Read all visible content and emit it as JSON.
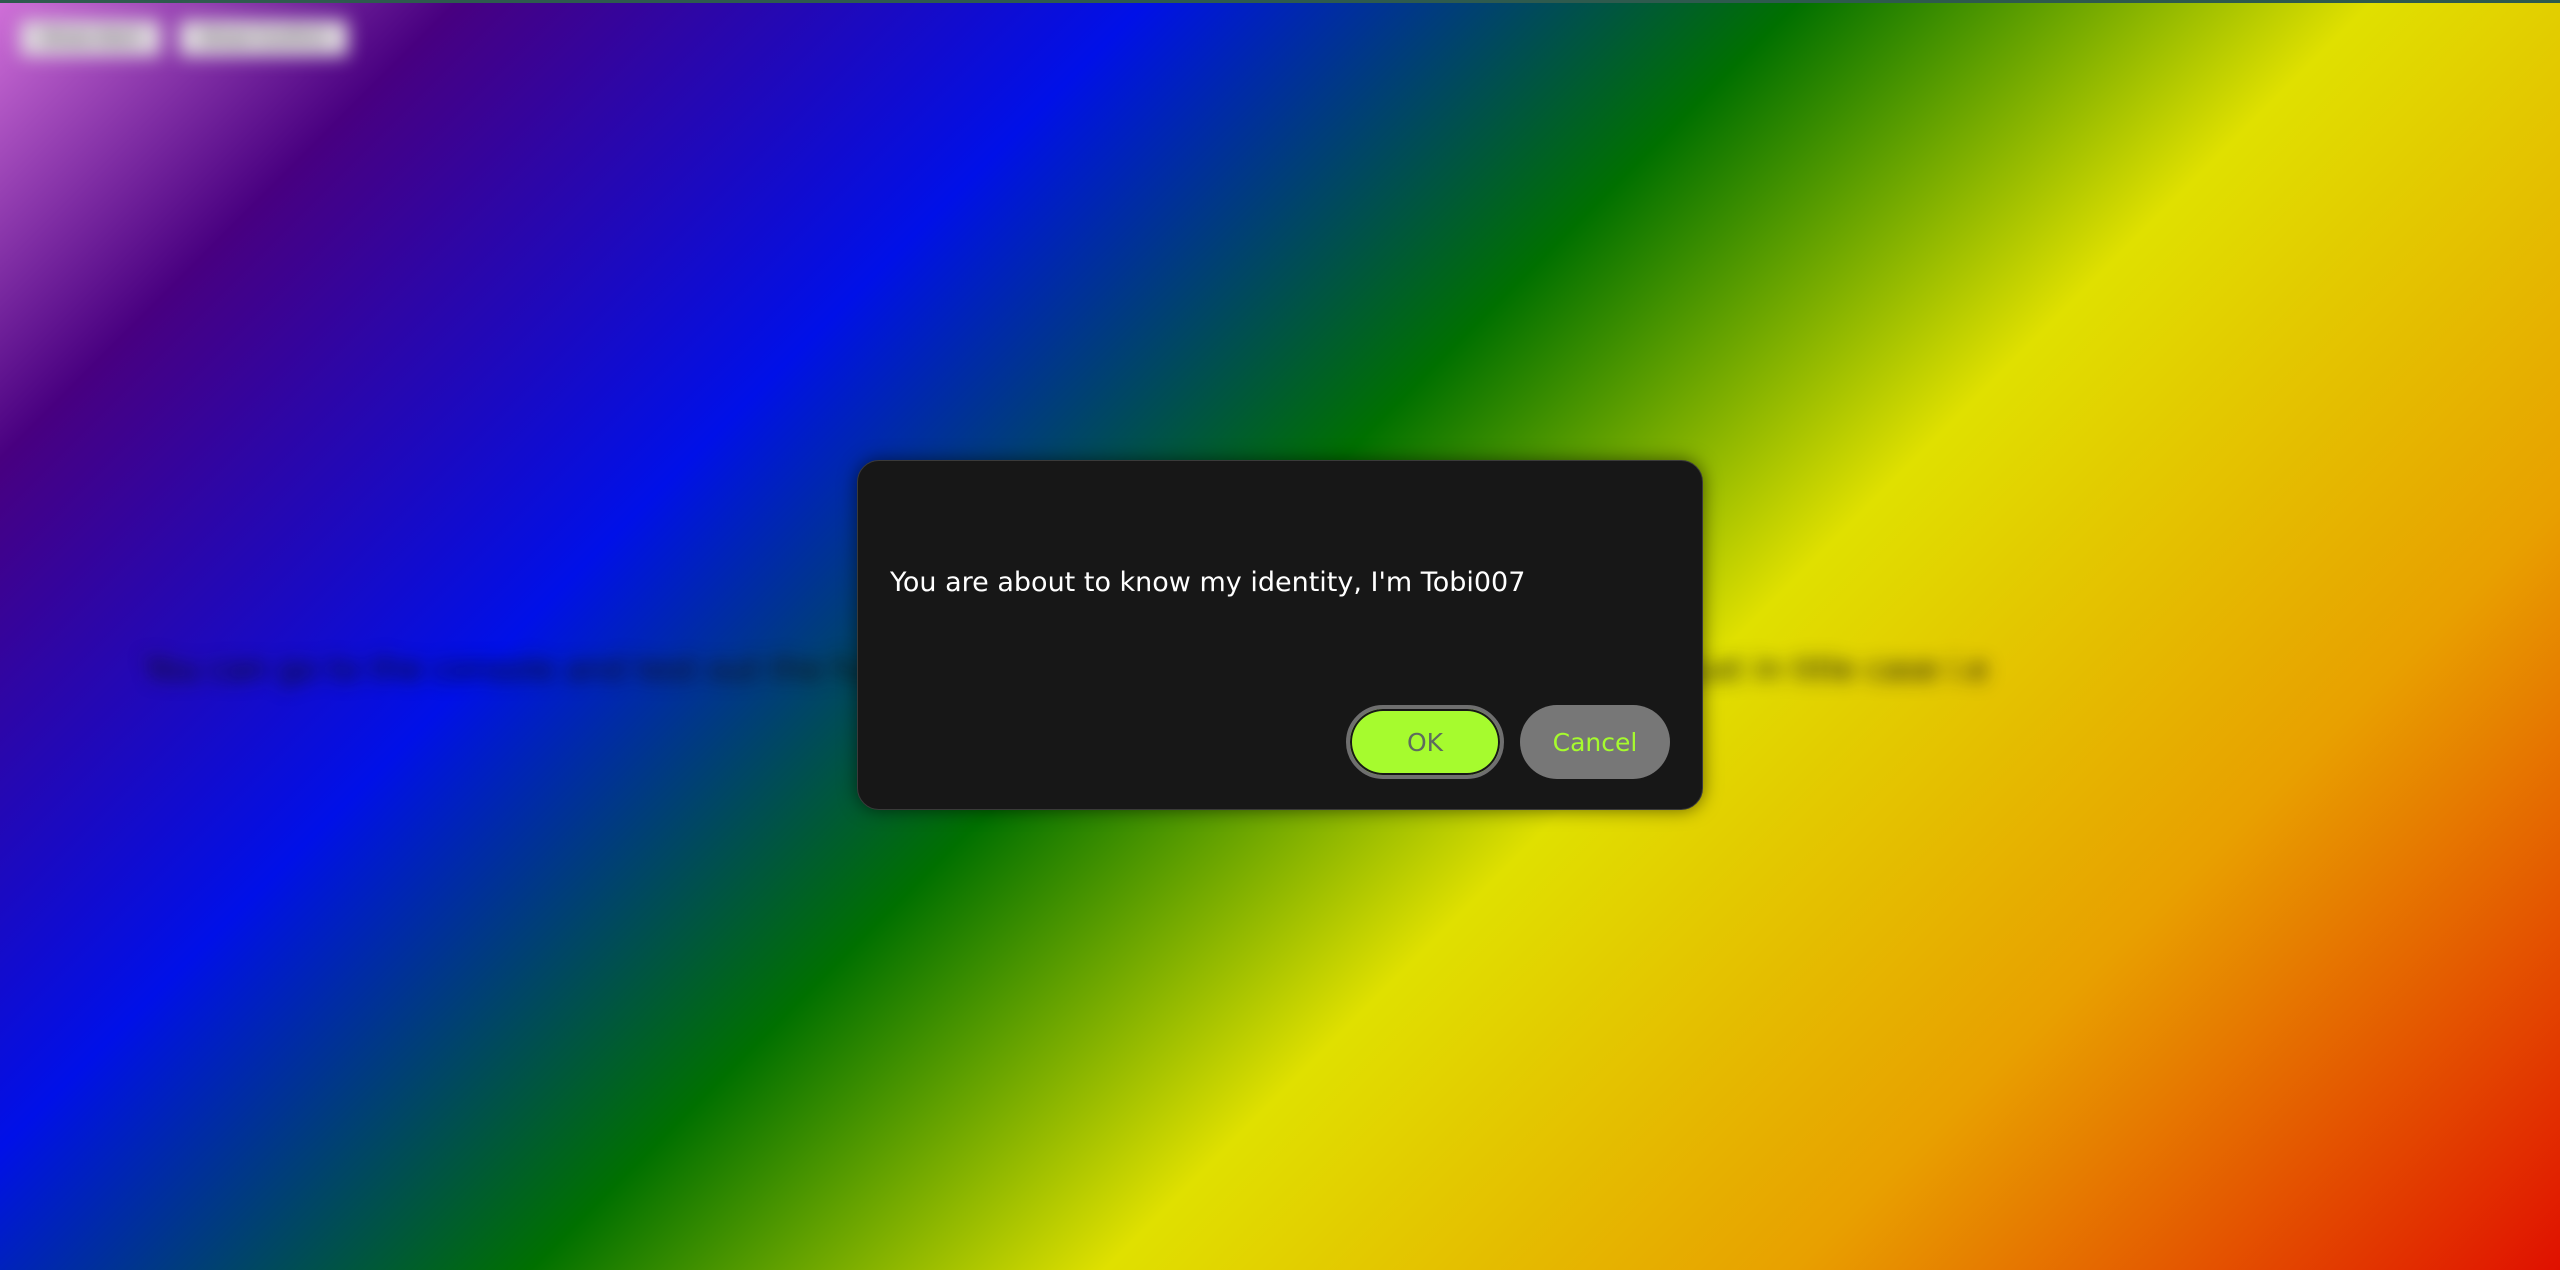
{
  "background": {
    "buttons": [
      "Show Alert",
      "Show Confirm"
    ],
    "text": "You can go to the console and test out the functions which override the browser default dialogs just in title case i.e"
  },
  "dialog": {
    "message": "You are about to know my identity, I'm Tobi007",
    "ok_label": "OK",
    "cancel_label": "Cancel"
  },
  "colors": {
    "dialog_bg": "#171717",
    "accent": "#a6fb2e",
    "cancel_bg": "#777777"
  }
}
